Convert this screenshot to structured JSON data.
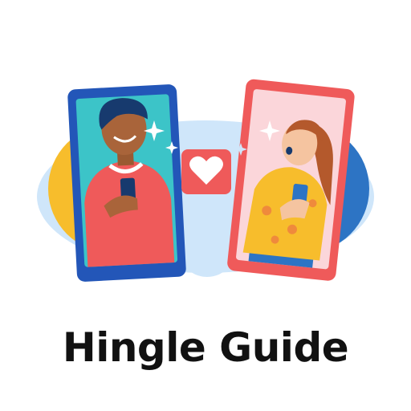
{
  "app": {
    "title": "Hingle Guide"
  },
  "colors": {
    "blue_phone": "#2356b8",
    "red_phone": "#ef5a5a",
    "heart_badge": "#ef5a5a",
    "blob_light_blue": "#cfe6fa",
    "blob_yellow": "#f7bd2c",
    "blob_blue": "#2d74c4"
  },
  "icons": [
    "heart-icon",
    "sparkle-icon"
  ]
}
